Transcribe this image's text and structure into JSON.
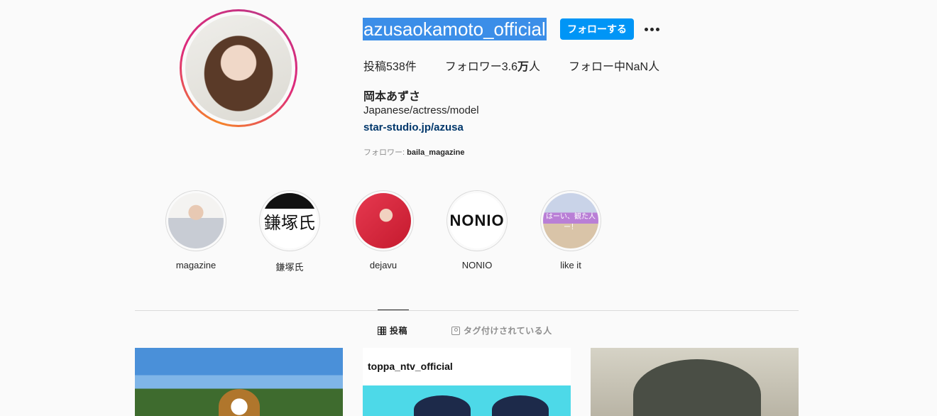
{
  "profile": {
    "username": "azusaokamoto_official",
    "follow_label": "フォローする",
    "more_label": "•••",
    "stats": {
      "posts_prefix": "投稿",
      "posts_count": "538",
      "posts_suffix": "件",
      "followers_prefix": "フォロワー",
      "followers_count": "3.6",
      "followers_unit": "万",
      "followers_suffix": "人",
      "following_prefix": "フォロー中",
      "following_count": "NaN",
      "following_suffix": "人"
    },
    "full_name": "岡本あずさ",
    "bio": "Japanese/actress/model",
    "link": "star-studio.jp/azusa",
    "followed_by_prefix": "フォロワー: ",
    "followed_by_user": "baila_magazine"
  },
  "highlights": [
    {
      "label": "magazine",
      "icon": "highlight-thumbnail"
    },
    {
      "label": "鎌塚氏",
      "icon": "highlight-thumbnail",
      "thumb_text": "鎌塚氏"
    },
    {
      "label": "dejavu",
      "icon": "highlight-thumbnail"
    },
    {
      "label": "NONIO",
      "icon": "highlight-thumbnail",
      "thumb_text": "NONIO"
    },
    {
      "label": "like it",
      "icon": "highlight-thumbnail",
      "thumb_text": "はーい、観た人ー！"
    }
  ],
  "tabs": {
    "posts": "投稿",
    "tagged": "タグ付けされている人",
    "active": "posts"
  },
  "posts": [
    {
      "caption": ""
    },
    {
      "caption": "toppa_ntv_official"
    },
    {
      "caption": ""
    }
  ],
  "colors": {
    "accent": "#0095f6",
    "link": "#00376b",
    "selection": "#3b8ee8",
    "background": "#fafafa"
  }
}
